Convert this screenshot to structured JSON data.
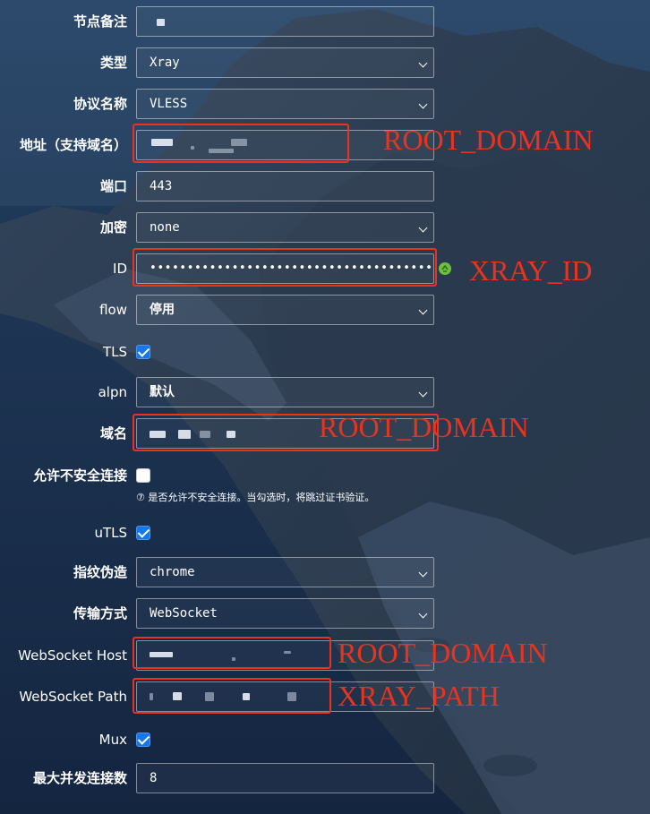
{
  "fields": [
    {
      "key": "remark",
      "label": "节点备注",
      "value": "",
      "kind": "input"
    },
    {
      "key": "type",
      "label": "类型",
      "value": "Xray",
      "kind": "select"
    },
    {
      "key": "protocol",
      "label": "协议名称",
      "value": "VLESS",
      "kind": "select"
    },
    {
      "key": "address",
      "label": "地址（支持域名）",
      "value": "",
      "kind": "input"
    },
    {
      "key": "port",
      "label": "端口",
      "value": "443",
      "kind": "input"
    },
    {
      "key": "encryption",
      "label": "加密",
      "value": "none",
      "kind": "select"
    },
    {
      "key": "id",
      "label": "ID",
      "value": "••••••••••••••••••••••••••••••••••••••",
      "kind": "password"
    },
    {
      "key": "flow",
      "label": "flow",
      "value": "停用",
      "kind": "select"
    },
    {
      "key": "tls",
      "label": "TLS",
      "checked": true,
      "kind": "checkbox"
    },
    {
      "key": "alpn",
      "label": "alpn",
      "value": "默认",
      "kind": "select"
    },
    {
      "key": "sni",
      "label": "域名",
      "value": "",
      "kind": "input"
    },
    {
      "key": "insecure",
      "label": "允许不安全连接",
      "checked": false,
      "kind": "checkbox",
      "help": "⑦ 是否允许不安全连接。当勾选时，将跳过证书验证。"
    },
    {
      "key": "utls",
      "label": "uTLS",
      "checked": true,
      "kind": "checkbox"
    },
    {
      "key": "fingerprint",
      "label": "指纹伪造",
      "value": "chrome",
      "kind": "select"
    },
    {
      "key": "transport",
      "label": "传输方式",
      "value": "WebSocket",
      "kind": "select"
    },
    {
      "key": "ws_host",
      "label": "WebSocket Host",
      "value": "",
      "kind": "input"
    },
    {
      "key": "ws_path",
      "label": "WebSocket Path",
      "value": "",
      "kind": "input"
    },
    {
      "key": "mux",
      "label": "Mux",
      "checked": true,
      "kind": "checkbox"
    },
    {
      "key": "max_conn",
      "label": "最大并发连接数",
      "value": "8",
      "kind": "input"
    }
  ],
  "annotations": {
    "address": "ROOT_DOMAIN",
    "id": "XRAY_ID",
    "sni": "ROOT_DOMAIN",
    "ws_host": "ROOT_DOMAIN",
    "ws_path": "XRAY_PATH"
  },
  "colors": {
    "annotation": "#e8341e",
    "checkbox": "#1677e8",
    "copy_icon": "#6fbf3f"
  },
  "icons": {
    "copy": "copy-icon",
    "dropdown": "chevron-down-icon",
    "help": "question-circle-icon"
  }
}
